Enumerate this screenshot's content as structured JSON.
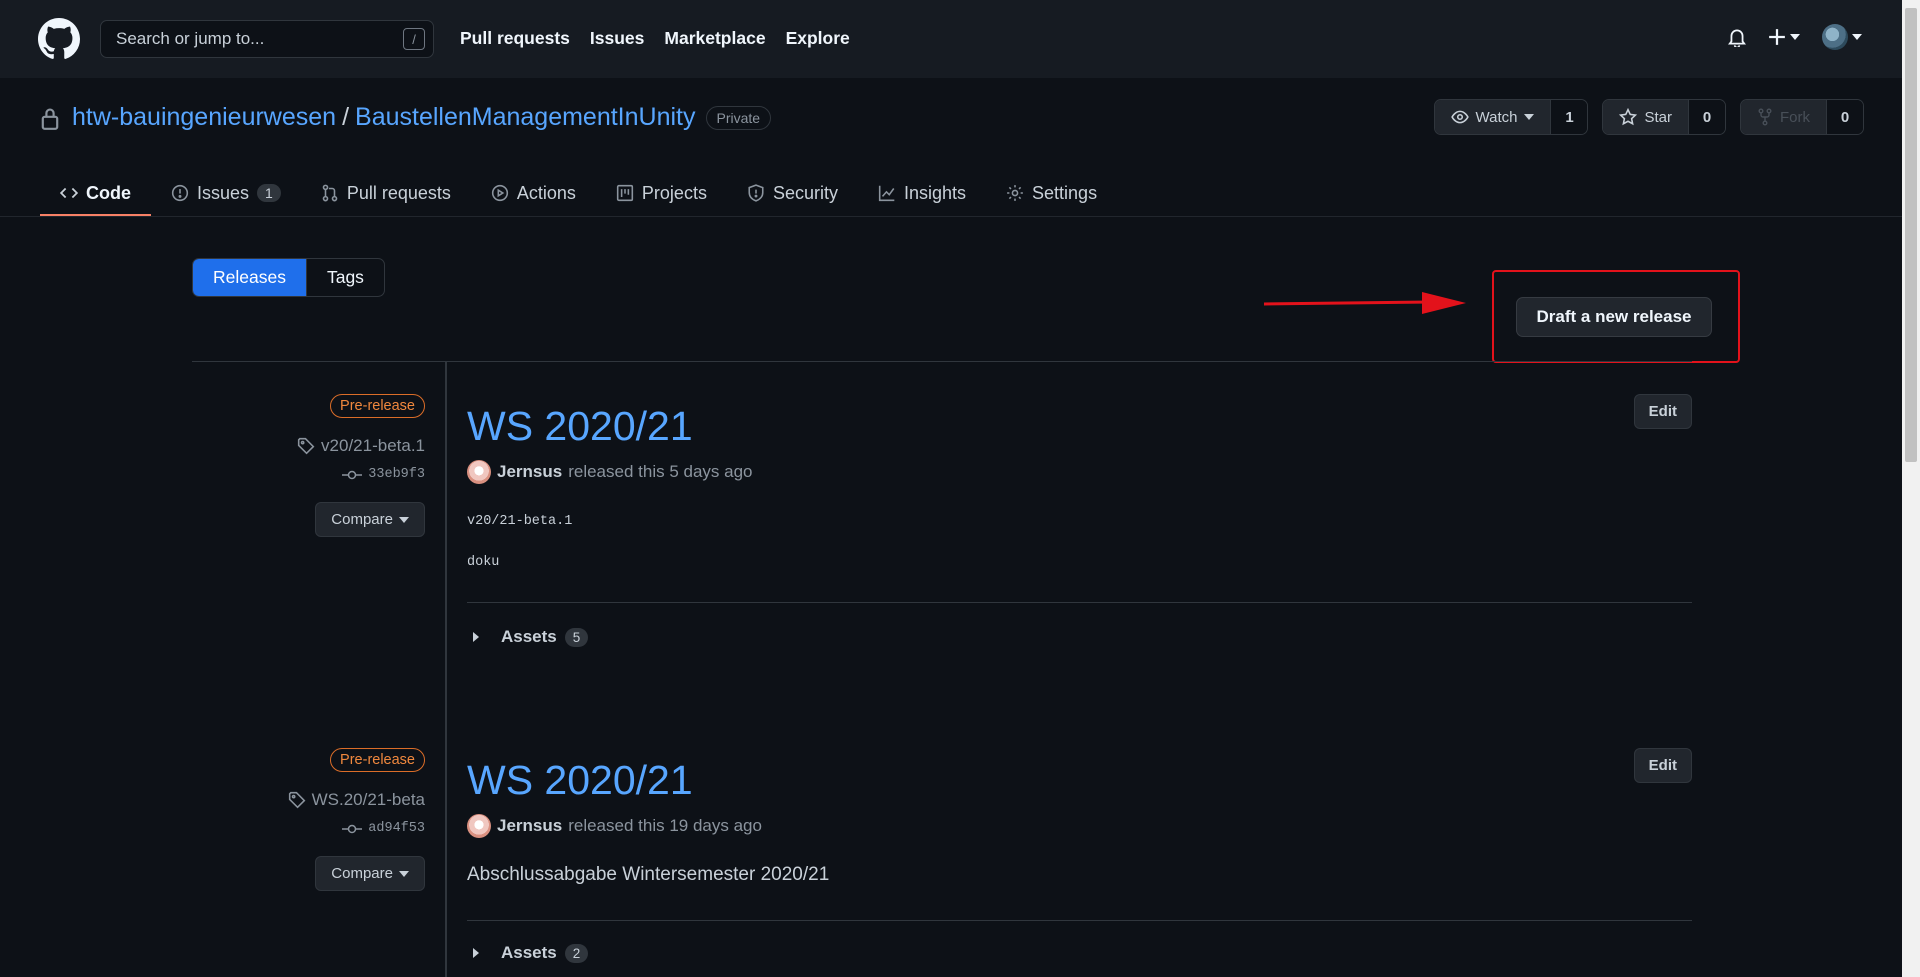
{
  "header": {
    "search_placeholder": "Search or jump to...",
    "search_shortcut": "/",
    "nav": [
      "Pull requests",
      "Issues",
      "Marketplace",
      "Explore"
    ]
  },
  "repo": {
    "owner": "htw-bauingenieurwesen",
    "separator": "/",
    "name": "BaustellenManagementInUnity",
    "visibility": "Private",
    "watch_label": "Watch",
    "watch_count": "1",
    "star_label": "Star",
    "star_count": "0",
    "fork_label": "Fork",
    "fork_count": "0"
  },
  "tabs": {
    "code": "Code",
    "issues": "Issues",
    "issues_count": "1",
    "pull_requests": "Pull requests",
    "actions": "Actions",
    "projects": "Projects",
    "security": "Security",
    "insights": "Insights",
    "settings": "Settings"
  },
  "subnav": {
    "releases": "Releases",
    "tags": "Tags"
  },
  "draft_button": "Draft a new release",
  "annotation_color": "#e3121b",
  "releases": [
    {
      "badge": "Pre-release",
      "tag": "v20/21-beta.1",
      "commit": "33eb9f3",
      "compare": "Compare",
      "title": "WS 2020/21",
      "edit": "Edit",
      "author": "Jernsus",
      "released": "released this 5 days ago",
      "code_line": "v20/21-beta.1",
      "code_line2": "doku",
      "assets_label": "Assets",
      "assets_count": "5"
    },
    {
      "badge": "Pre-release",
      "tag": "WS.20/21-beta",
      "commit": "ad94f53",
      "compare": "Compare",
      "title": "WS 2020/21",
      "edit": "Edit",
      "author": "Jernsus",
      "released": "released this 19 days ago",
      "body": "Abschlussabgabe Wintersemester 2020/21",
      "assets_label": "Assets",
      "assets_count": "2"
    }
  ]
}
